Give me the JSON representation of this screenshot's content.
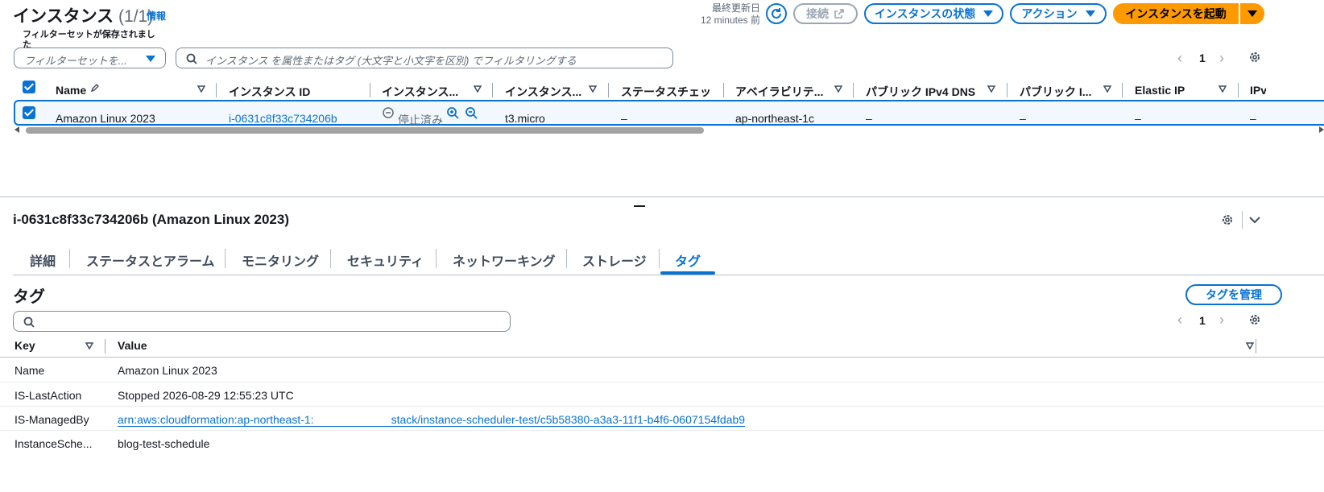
{
  "header": {
    "title": "インスタンス",
    "count": "(1/1)",
    "info": "情報",
    "last_updated_label": "最終更新日",
    "last_updated_value": "12 minutes 前",
    "connect_label": "接続",
    "state_label": "インスタンスの状態",
    "actions_label": "アクション",
    "launch_label": "インスタンスを起動",
    "colors": {
      "accent": "#0972d3",
      "primary": "#ff9900"
    }
  },
  "filter": {
    "saved_note": "フィルターセットが保存されました",
    "filter_set_placeholder": "フィルターセットを...",
    "search_placeholder": "インスタンス を属性またはタグ (大文字と小文字を区別) でフィルタリングする",
    "page": "1"
  },
  "table": {
    "columns": [
      "Name",
      "インスタンス ID",
      "インスタンス...",
      "インスタンス...",
      "ステータスチェック",
      "アベイラビリテ...",
      "パブリック IPv4 DNS",
      "パブリック I...",
      "Elastic IP",
      "IPv"
    ],
    "row": {
      "name": "Amazon Linux 2023",
      "instance_id": "i-0631c8f33c734206b",
      "state": "停止済み",
      "type": "t3.micro",
      "status_check": "–",
      "az": "ap-northeast-1c",
      "public_dns": "–",
      "public_ip": "–",
      "elastic_ip": "–",
      "ipv6": "–"
    }
  },
  "detail": {
    "title": "i-0631c8f33c734206b (Amazon Linux 2023)",
    "tabs": [
      "詳細",
      "ステータスとアラーム",
      "モニタリング",
      "セキュリティ",
      "ネットワーキング",
      "ストレージ",
      "タグ"
    ],
    "active_tab": "タグ"
  },
  "tags": {
    "heading": "タグ",
    "manage_label": "タグを管理",
    "page": "1",
    "columns": [
      "Key",
      "Value"
    ],
    "rows": [
      {
        "key": "Name",
        "value": "Amazon Linux 2023"
      },
      {
        "key": "IS-LastAction",
        "value": "Stopped 2026-08-29 12:55:23 UTC"
      },
      {
        "key": "IS-ManagedBy",
        "value_part1": "arn:aws:cloudformation:ap-northeast-1:",
        "value_part2": "stack/instance-scheduler-test/c5b58380-a3a3-11f1-b4f6-0607154fdab9"
      },
      {
        "key": "InstanceSche...",
        "value": "blog-test-schedule"
      }
    ]
  }
}
